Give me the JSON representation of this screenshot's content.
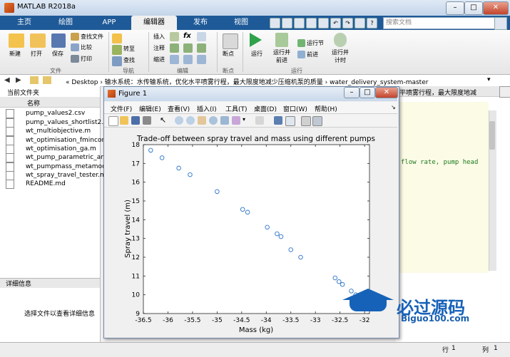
{
  "window": {
    "title": "MATLAB R2018a"
  },
  "tabs": [
    "主页",
    "绘图",
    "APP",
    "编辑器",
    "发布",
    "视图"
  ],
  "search": {
    "placeholder": "搜索文档"
  },
  "toolstrip": {
    "new": "新建",
    "open": "打开",
    "save": "保存",
    "find_files": "查找文件",
    "compare": "比较",
    "print": "打印",
    "insert": "插入",
    "comment": "注释",
    "indent": "缩进",
    "goto": "转至",
    "find": "查找",
    "breakpoints": "断点",
    "run": "运行",
    "run_advance": [
      "运行并",
      "前进"
    ],
    "run_section": "运行节",
    "advance": "前进",
    "run_time": [
      "运行并",
      "计时"
    ],
    "groups": {
      "file": "文件",
      "navigate": "导航",
      "edit": "编辑",
      "breakpoints": "断点",
      "run": "运行"
    }
  },
  "address": {
    "path": "« Desktop › 输水系统：水传输系统，优化水平喷雾行程，最大限度地减少压缩机泵的质量 › water_delivery_system-master"
  },
  "left_panel": {
    "title": "当前文件夹",
    "column": "名称",
    "files": [
      "pump_values2.csv",
      "pump_values_shortlist2.csv",
      "wt_multiobjective.m",
      "wt_optimisation_fmincon.m",
      "wt_optimisation_ga.m",
      "wt_pump_parametric_anal",
      "wt_pumpmass_metamode",
      "wt_spray_travel_tester.m",
      "README.md"
    ],
    "detail_title": "详细信息",
    "detail_msg": "选择文件以查看详细信息"
  },
  "editor": {
    "line1": "flow rate, pump head",
    "header_snip": "平喷雾行程，最大限度地减"
  },
  "status": {
    "row_label": "行",
    "row": "1",
    "col_label": "列",
    "col": "1"
  },
  "figure": {
    "title": "Figure 1",
    "menu": [
      "文件(F)",
      "编辑(E)",
      "查看(V)",
      "插入(I)",
      "工具(T)",
      "桌面(D)",
      "窗口(W)",
      "帮助(H)"
    ]
  },
  "watermark": {
    "text": "必过源码",
    "url": "Biguo100.com"
  },
  "colors": {
    "marker": "#2a72c8",
    "tabbar": "#1f5a98",
    "watermark": "#1662b8"
  },
  "chart_data": {
    "type": "scatter",
    "title": "Trade-off between spray travel and mass using different pumps",
    "xlabel": "Mass (kg)",
    "ylabel": "Spray travel (m)",
    "xlim": [
      -36.5,
      -31.9
    ],
    "ylim": [
      9,
      18
    ],
    "xticks": [
      -36.5,
      -36,
      -35.5,
      -35,
      -34.5,
      -34,
      -33.5,
      -33,
      -32.5,
      -32
    ],
    "xticklabels": [
      "-36.5",
      "-36",
      "-35.5",
      "-35",
      "-34.5",
      "-34",
      "-33.5",
      "-33",
      "-32.5",
      "-32"
    ],
    "yticks": [
      9,
      10,
      11,
      12,
      13,
      14,
      15,
      16,
      17,
      18
    ],
    "yticklabels": [
      "9",
      "10",
      "11",
      "12",
      "13",
      "14",
      "15",
      "16",
      "17",
      "18"
    ],
    "x": [
      -36.35,
      -36.12,
      -35.78,
      -35.55,
      -35.0,
      -34.48,
      -34.38,
      -33.98,
      -33.78,
      -33.7,
      -33.5,
      -33.3,
      -32.6,
      -32.52,
      -32.45,
      -32.27,
      -32.18,
      -32.08
    ],
    "y": [
      17.7,
      17.3,
      16.75,
      16.4,
      15.5,
      14.55,
      14.4,
      13.6,
      13.25,
      13.1,
      12.4,
      12.0,
      10.9,
      10.7,
      10.55,
      10.2,
      10.0,
      9.85
    ]
  }
}
